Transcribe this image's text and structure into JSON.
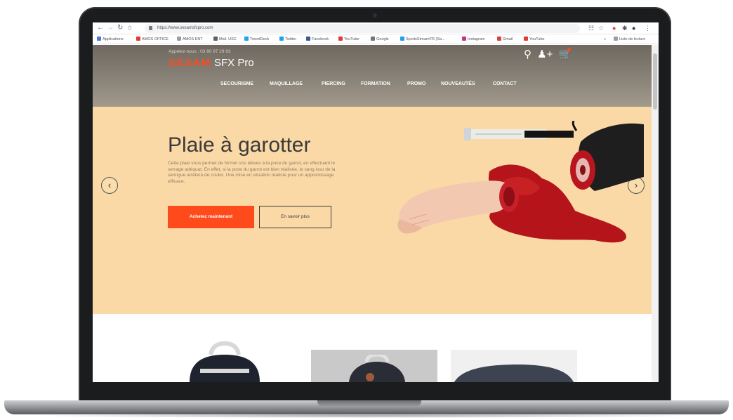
{
  "browser": {
    "url": "https://www.sesamsfxpro.com",
    "bookmarks": [
      {
        "label": "Applications",
        "color": "#4a78d6"
      },
      {
        "label": "AMOS OFFICE",
        "color": "#e53935"
      },
      {
        "label": "AMOS ENT",
        "color": "#9e9e9e"
      },
      {
        "label": "Mail. USC",
        "color": "#616161"
      },
      {
        "label": "TweetDeck",
        "color": "#1da1f2"
      },
      {
        "label": "Twitter",
        "color": "#1da1f2"
      },
      {
        "label": "Facebook",
        "color": "#3b5998"
      },
      {
        "label": "YouTube",
        "color": "#e53935"
      },
      {
        "label": "Google",
        "color": "#757575"
      },
      {
        "label": "SportsStreamFR (Sa...",
        "color": "#1da1f2"
      },
      {
        "label": "Instagram",
        "color": "#c13584"
      },
      {
        "label": "Gmail",
        "color": "#d44638"
      },
      {
        "label": "YouTube",
        "color": "#e53935"
      }
    ],
    "reading_list": "Liste de lecture"
  },
  "header": {
    "phone": "Appelez-nous : 03 80 97 29 93",
    "logo_part1": "SESAM",
    "logo_part2": "SFX Pro",
    "icons": [
      "search-icon",
      "add-user-icon",
      "cart-icon"
    ],
    "nav": [
      "SECOURISME",
      "MAQUILLAGE",
      "PIERCING",
      "FORMATION",
      "PROMO",
      "NOUVEAUTÉS",
      "CONTACT"
    ]
  },
  "hero": {
    "title": "Plaie à garotter",
    "description": "Cette plaie vous permet de former vos élèves à la pose du garrot, en effectuant le serrage adéquat. En effet, si la pose du garrot est bien réalisée, le sang issu de la seringue arrêtera de couler. Une mise en situation réaliste pour un apprentissage efficace.",
    "buy_label": "Achetez maintenant",
    "more_label": "En savoir plus",
    "prev_label": "‹",
    "next_label": "›"
  },
  "colors": {
    "accent": "#ff4a1c",
    "hero_bg": "#fbd9a6"
  }
}
